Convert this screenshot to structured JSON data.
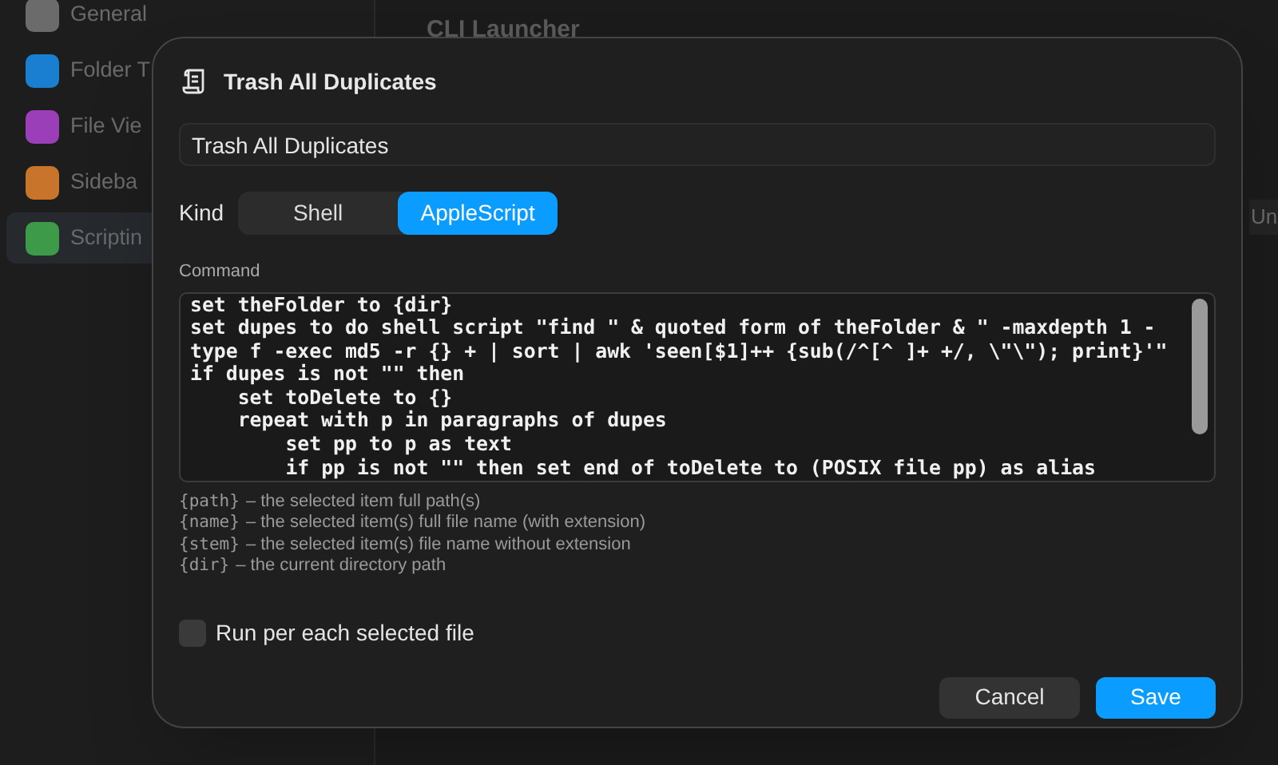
{
  "sidebar": {
    "items": [
      {
        "label": "General",
        "color": "#6b6b6b",
        "selected": false
      },
      {
        "label": "Folder T",
        "color": "#1a7fd0",
        "selected": false
      },
      {
        "label": "File Vie",
        "color": "#9a3fb8",
        "selected": false
      },
      {
        "label": "Sideba",
        "color": "#c8742a",
        "selected": false
      },
      {
        "label": "Scriptin",
        "color": "#3c9a48",
        "selected": true
      }
    ]
  },
  "main": {
    "title": "CLI Launcher",
    "column_3": "Un"
  },
  "dialog": {
    "title": "Trash All Duplicates",
    "name_field": {
      "value": "Trash All Duplicates"
    },
    "kind": {
      "label": "Kind",
      "options": [
        {
          "label": "Shell",
          "selected": false
        },
        {
          "label": "AppleScript",
          "selected": true
        }
      ]
    },
    "command": {
      "label": "Command",
      "value": "set theFolder to {dir}\nset dupes to do shell script \"find \" & quoted form of theFolder & \" -maxdepth 1 -type f -exec md5 -r {} + | sort | awk 'seen[$1]++ {sub(/^[^ ]+ +/, \\\"\\\"); print}'\"\nif dupes is not \"\" then\n\tset toDelete to {}\n\trepeat with p in paragraphs of dupes\n\t\tset pp to p as text\n\t\tif pp is not \"\" then set end of toDelete to (POSIX file pp) as alias"
    },
    "help": [
      {
        "token": "{path}",
        "text": "– the selected item full path(s)"
      },
      {
        "token": "{name}",
        "text": "– the selected item(s) full file name (with extension)"
      },
      {
        "token": "{stem}",
        "text": "– the selected item(s) file name without extension"
      },
      {
        "token": "{dir}",
        "text": "– the current directory path"
      }
    ],
    "run_per_file": {
      "label": "Run per each selected file",
      "checked": false
    },
    "buttons": [
      {
        "label": "Cancel",
        "kind": "secondary"
      },
      {
        "label": "Save",
        "kind": "primary"
      }
    ]
  }
}
